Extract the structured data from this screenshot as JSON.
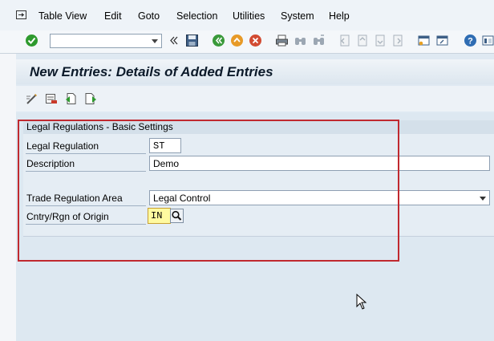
{
  "menu": {
    "items": [
      "Table View",
      "Edit",
      "Goto",
      "Selection",
      "Utilities",
      "System",
      "Help"
    ]
  },
  "toolbar": {
    "command_field": {
      "value": "",
      "placeholder": ""
    }
  },
  "page": {
    "title": "New Entries: Details of Added Entries"
  },
  "group": {
    "title": "Legal Regulations - Basic Settings",
    "fields": {
      "legal_regulation": {
        "label": "Legal Regulation",
        "value": "ST"
      },
      "description": {
        "label": "Description",
        "value": "Demo"
      },
      "trade_regulation_area": {
        "label": "Trade Regulation Area",
        "value": "Legal Control"
      },
      "country_of_origin": {
        "label": "Cntry/Rgn of Origin",
        "value": "IN"
      }
    }
  },
  "icons": {
    "toolbar": [
      "enter-icon",
      "back-icon",
      "exit-icon",
      "cancel-icon",
      "save-icon",
      "print-icon",
      "find-icon",
      "find-next-icon",
      "first-page-icon",
      "previous-page-icon",
      "next-page-icon",
      "last-page-icon",
      "create-session-icon",
      "shortcut-icon",
      "help-icon",
      "customize-layout-icon"
    ],
    "application": [
      "change-display-icon",
      "delete-icon",
      "previous-entry-icon",
      "next-entry-icon"
    ]
  },
  "colors": {
    "highlight_border": "#c0292f",
    "required_field": "#fffaa0",
    "enter_icon": "#2e9a2e"
  }
}
